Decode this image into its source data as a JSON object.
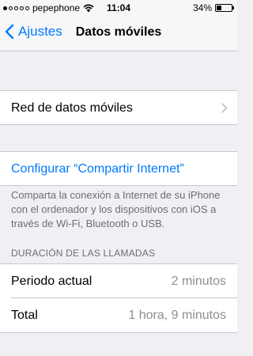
{
  "status_bar": {
    "carrier": "pepephone",
    "time": "11:04",
    "battery_text": "34%",
    "battery_level": 0.34,
    "signal_bars": 1,
    "signal_total": 5
  },
  "nav": {
    "back_label": "Ajustes",
    "title": "Datos móviles"
  },
  "cells": {
    "cellular_data": {
      "label": "Red de datos móviles"
    },
    "hotspot": {
      "label": "Configurar “Compartir Internet”",
      "footer": "Comparta la conexión a Internet de su iPhone con el ordenador y los dispositivos con iOS a través de Wi-Fi, Bluetooth o USB."
    }
  },
  "call_duration": {
    "header": "DURACIÓN DE LAS LLAMADAS",
    "rows": [
      {
        "label": "Periodo actual",
        "value": "2 minutos"
      },
      {
        "label": "Total",
        "value": "1 hora, 9 minutos"
      }
    ]
  },
  "colors": {
    "accent": "#007aff",
    "background": "#efeff4",
    "secondary_text": "#8e8e93"
  }
}
